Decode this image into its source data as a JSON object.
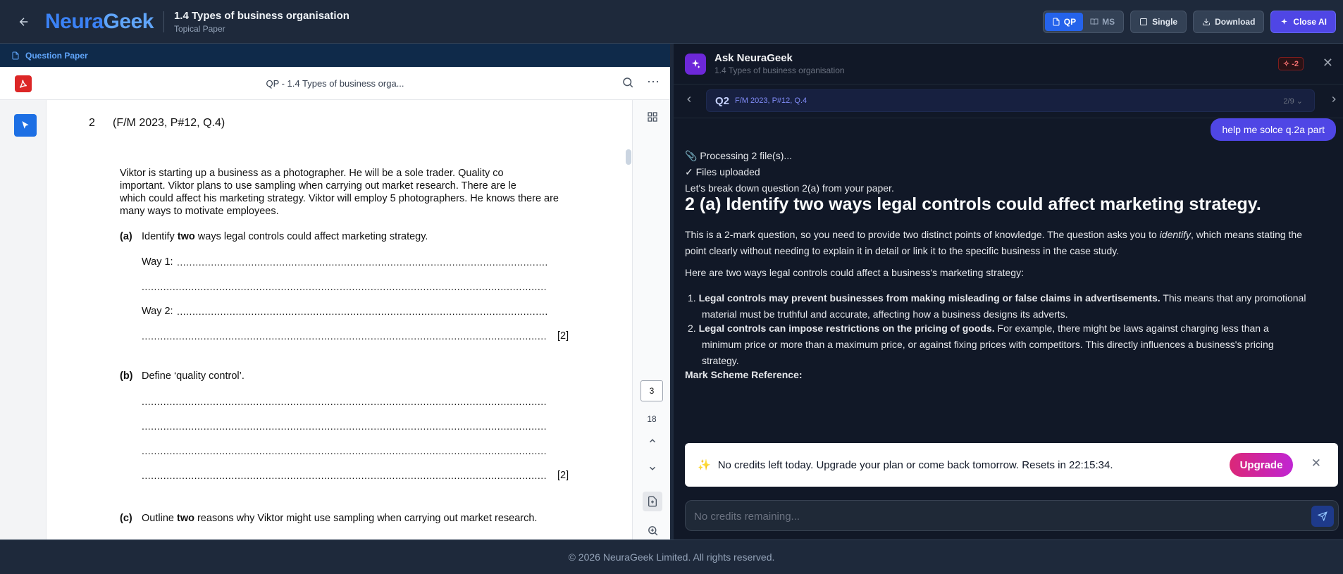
{
  "topbar": {
    "logo_a": "Neura",
    "logo_b": "Geek",
    "title": "1.4 Types of business organisation",
    "subtitle": "Topical Paper",
    "qp_label": "QP",
    "ms_label": "MS",
    "single_label": "Single",
    "download_label": "Download",
    "close_ai_label": "Close AI"
  },
  "viewer": {
    "tab_label": "Question Paper",
    "doc_title": "QP - 1.4 Types of business orga...",
    "current_page": "3",
    "total_pages": "18"
  },
  "paper": {
    "q_number": "2",
    "q_ref": "(F/M 2023, P#12, Q.4)",
    "intro_lines": [
      "Viktor is starting up a business as a photographer. He will be a sole trader. Quality co",
      "important. Viktor plans to use sampling when carrying out market research. There are le",
      "which could affect his marketing strategy. Viktor will employ 5 photographers. He knows there are",
      "many ways to motivate employees."
    ],
    "a_label": "(a)",
    "a_text_pre": "Identify ",
    "a_text_bold": "two",
    "a_text_post": " ways legal controls could affect marketing strategy.",
    "way1": "Way 1:",
    "way2": "Way 2:",
    "marks_a": "[2]",
    "b_label": "(b)",
    "b_text": "Define ‘quality control’.",
    "marks_b": "[2]",
    "c_label": "(c)",
    "c_text_pre": "Outline ",
    "c_text_bold": "two",
    "c_text_post": " reasons why Viktor might use sampling when carrying out market research."
  },
  "ai": {
    "title": "Ask NeuraGeek",
    "subtitle": "1.4 Types of business organisation",
    "credit_badge": "-2",
    "nav_q": "Q2",
    "nav_ref": "F/M 2023, P#12, Q.4",
    "nav_count": "2/9",
    "user_msg": "help me solce q.2a part",
    "line1": "📎 Processing 2 file(s)...",
    "line2": "✓ Files uploaded",
    "line3": "Let's break down question 2(a) from your paper.",
    "heading": "2 (a) Identify two ways legal controls could affect marketing strategy.",
    "para1_pre": "This is a 2-mark question, so you need to provide two distinct points of knowledge. The question asks you to ",
    "para1_em": "identify",
    "para1_post": ", which means stating the point clearly without needing to explain it in detail or link it to the specific business in the case study.",
    "para2": "Here are two ways legal controls could affect a business's marketing strategy:",
    "item1_num": "1.",
    "item1_bold": "Legal controls may prevent businesses from making misleading or false claims in advertisements.",
    "item1_rest": " This means that any promotional material must be truthful and accurate, affecting how a business designs its adverts.",
    "item2_num": "2.",
    "item2_bold": "Legal controls can impose restrictions on the pricing of goods.",
    "item2_rest": " For example, there might be laws against charging less than a minimum price or more than a maximum price, or against fixing prices with competitors. This directly influences a business's pricing strategy.",
    "ms_ref": "Mark Scheme Reference:",
    "notice_icon": "✨",
    "notice_text": "No credits left today. Upgrade your plan or come back tomorrow. Resets in 22:15:34.",
    "upgrade_label": "Upgrade",
    "input_placeholder": "No credits remaining..."
  },
  "footer": {
    "text": "© 2026 NeuraGeek Limited. All rights reserved."
  },
  "colors": {
    "accent": "#2563eb",
    "ai_accent": "#4f46e5",
    "upgrade": "#db2777",
    "pdf_red": "#dc2626"
  }
}
